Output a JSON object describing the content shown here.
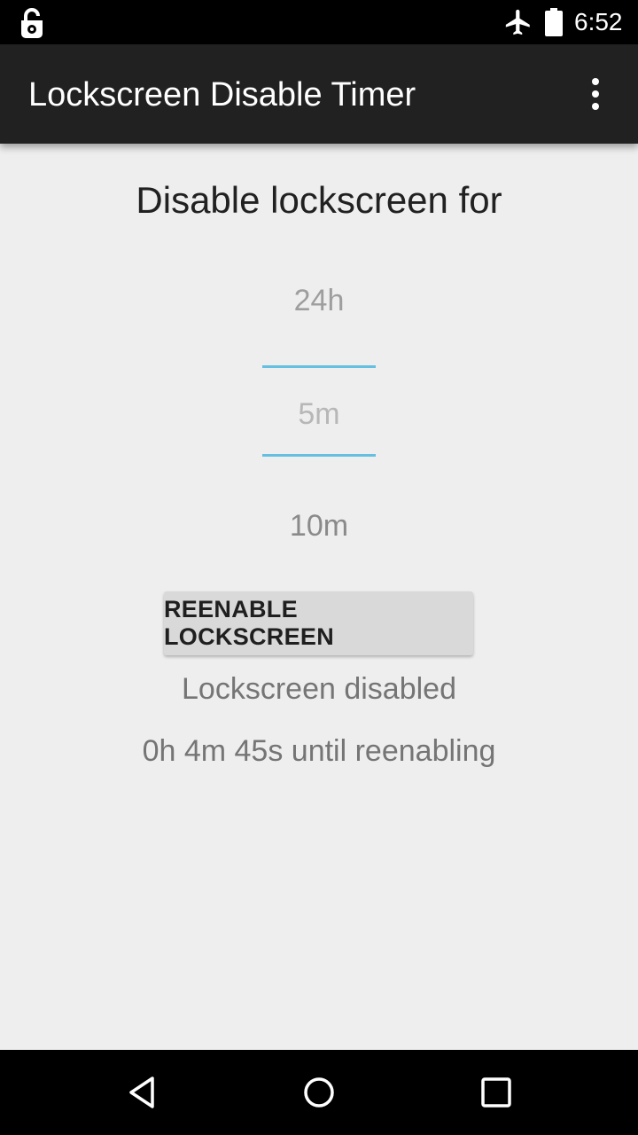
{
  "status_bar": {
    "time": "6:52",
    "icons": [
      "lock-open-icon",
      "airplane-mode-icon",
      "battery-icon"
    ]
  },
  "app_bar": {
    "title": "Lockscreen Disable Timer",
    "menu_icon": "more-vert-icon"
  },
  "main": {
    "heading": "Disable lockscreen for",
    "picker": {
      "previous": "24h",
      "selected": "5m",
      "next": "10m"
    },
    "reenable_button_label": "REENABLE LOCKSCREEN",
    "status": "Lockscreen disabled",
    "countdown": "0h 4m 45s until reenabling"
  },
  "nav_bar": {
    "buttons": [
      "back-icon",
      "home-icon",
      "recents-icon"
    ]
  },
  "colors": {
    "app_bar": "#212121",
    "background": "#eeeeee",
    "picker_divider": "#64bfe0",
    "button": "#d9d9d9"
  }
}
